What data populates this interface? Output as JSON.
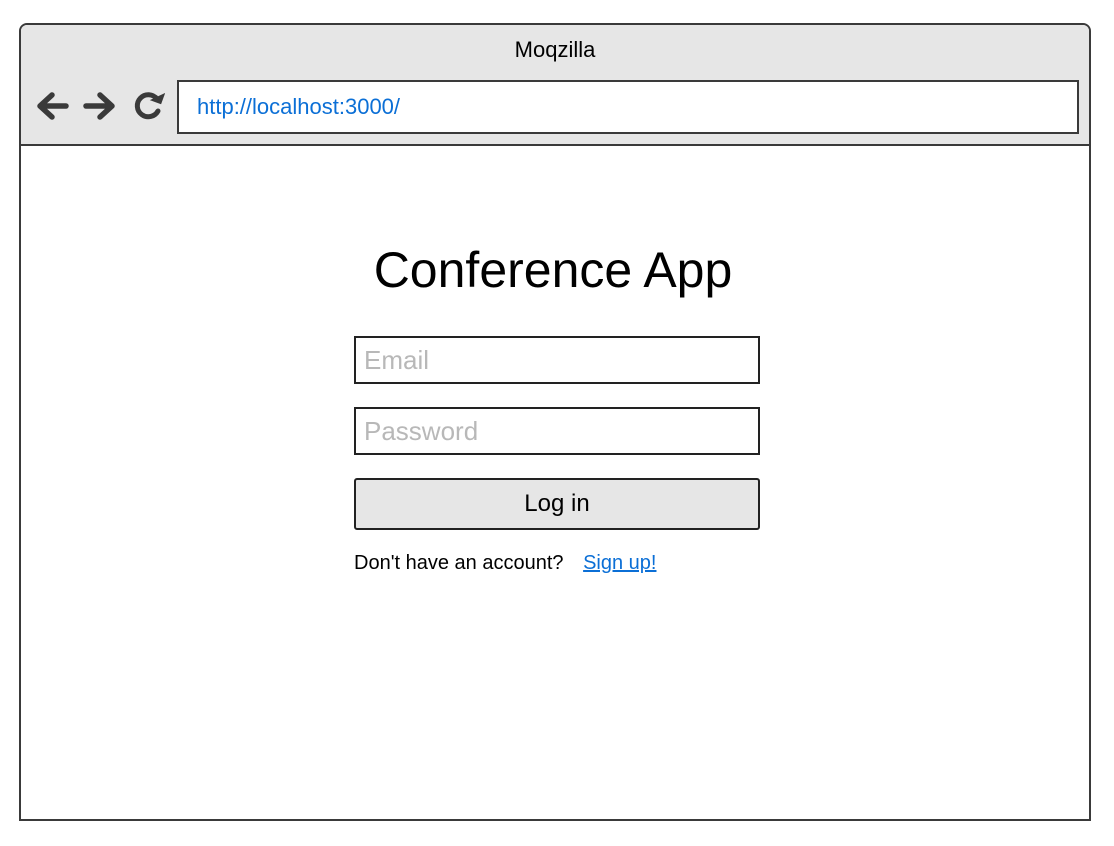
{
  "window": {
    "title": "Moqzilla"
  },
  "toolbar": {
    "back_icon": "arrow-left-icon",
    "forward_icon": "arrow-right-icon",
    "reload_icon": "reload-icon",
    "url": "http://localhost:3000/"
  },
  "login": {
    "title": "Conference App",
    "email_placeholder": "Email",
    "email_value": "",
    "password_placeholder": "Password",
    "password_value": "",
    "login_label": "Log in",
    "signup_prompt": "Don't have an account?",
    "signup_link": "Sign up!"
  },
  "colors": {
    "chrome_background": "#e6e6e6",
    "link": "#0b6fd6",
    "placeholder": "#b8b8b8",
    "button_background": "#e6e6e6",
    "border": "#222222"
  }
}
